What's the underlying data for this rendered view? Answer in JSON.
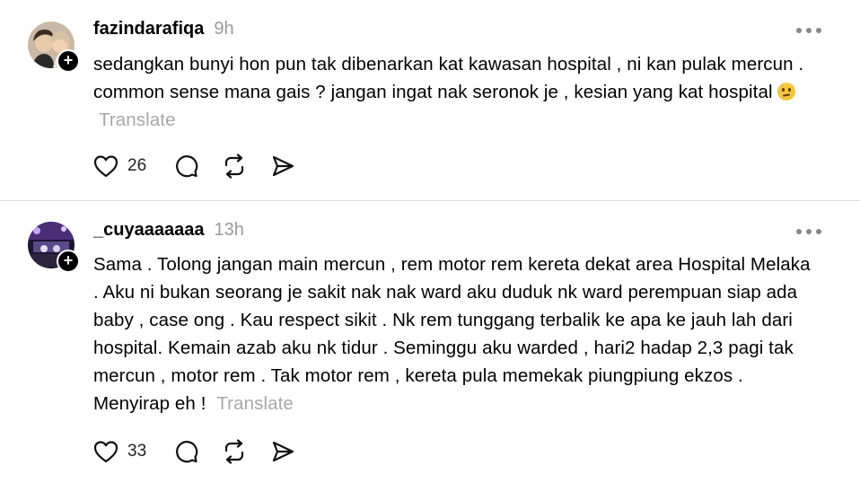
{
  "posts": [
    {
      "username": "fazindarafiqa",
      "time": "9h",
      "text": "sedangkan bunyi hon pun tak dibenarkan kat kawasan hospital , ni kan pulak mercun . common sense mana gais ? jangan ingat nak seronok je , kesian yang kat hospital",
      "emoji": "confused-face",
      "translate": "Translate",
      "likes": "26",
      "follow_symbol": "+"
    },
    {
      "username": "_cuyaaaaaaa",
      "time": "13h",
      "text": "Sama . Tolong jangan main mercun , rem motor rem kereta dekat area Hospital Melaka . Aku ni bukan seorang je sakit nak nak ward aku duduk nk ward perempuan siap ada baby , case ong . Kau respect sikit . Nk rem tunggang terbalik ke apa ke jauh lah dari hospital. Kemain azab aku nk tidur . Seminggu aku warded , hari2 hadap 2,3 pagi tak mercun , motor rem . Tak motor rem , kereta pula memekak piungpiung ekzos . Menyirap eh !",
      "translate": "Translate",
      "likes": "33",
      "follow_symbol": "+"
    }
  ],
  "icons": {
    "like": "heart-icon",
    "reply": "comment-icon",
    "repost": "repost-icon",
    "share": "send-icon",
    "more": "more-icon"
  },
  "colors": {
    "time": "#9a9a9a",
    "translate": "#a8a8a8",
    "divider": "#dcdcdc"
  }
}
